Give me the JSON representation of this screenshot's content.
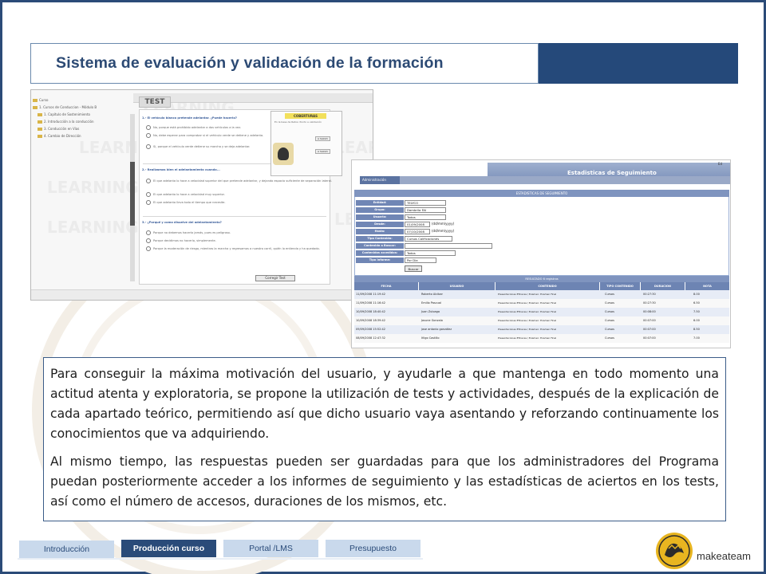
{
  "title": "Sistema de evaluación y validación de la formación",
  "colors": {
    "brand": "#25497a",
    "accent": "#c9d9ec",
    "logo": "#e8b520"
  },
  "shot_test": {
    "tab_label": "TEST",
    "watermark": "LEARNING",
    "tree": [
      "Curso",
      "1. Cursos de Conduccion - Módulo B",
      "1. Capítulo de Sostenimiento",
      "2. Introducción a la conducción",
      "3. Conducción en Vías",
      "4. Cambio de Dirección"
    ],
    "questions": [
      {
        "q": "1.- El vehículo blanco pretende adelantar. ¿Puede hacerlo?",
        "options": [
          "No, porque está prohibido adelantar a dos vehículos a la vez.",
          "No, debe esperar para comprobar si el vehículo verde se detiene y adelanta.",
          "Sí, porque el vehículo verde detiene su marcha y se deja adelantar."
        ]
      },
      {
        "q": "2.- Realizamos bien el adelantamiento cuando...",
        "options": [
          "El que adelanta lo hace a velocidad superior del que pretende adelantar, y dejando espacio suficiente de separación lateral.",
          "El que adelanta lo hace a velocidad muy superior.",
          "El que adelanta lleva todo el tiempo que necesite."
        ]
      },
      {
        "q": "3.- ¿Porqué y como disuelve del adelantamiento?",
        "options": [
          "Porque no debemos hacerlo jamás, pues es peligroso.",
          "Porque decidimos no hacerlo, simplemente.",
          "Porque la moderación de riesgo, mientras la marcha y regresamos a nuestro carril, quién lo entienda y ha quedado."
        ]
      }
    ],
    "coberturas": {
      "title": "COBERTURAS",
      "subtitle": "En la base de Retos: Punto a validación",
      "btn_a": "A SALVO",
      "btn_b": "A SALVO"
    },
    "submit": "Corregir Test"
  },
  "shot_stats": {
    "header": "Estadisticas de Seguimiento",
    "edit": "Ed",
    "tab": "Administración",
    "box_title": "ESTADISTICAS DE SEGUIMIENTO",
    "form": [
      {
        "label": "Entidad:",
        "value": "TELYCO"
      },
      {
        "label": "Grupo:",
        "value": "Dambrila FAI"
      },
      {
        "label": "Usuario:",
        "value": "Todos"
      },
      {
        "label": "Desde:",
        "value": "01/09/2008",
        "hint": "(dd/mm/yyyy)"
      },
      {
        "label": "Hasta:",
        "value": "07/10/2008",
        "hint": "(dd/mm/yyyy)"
      },
      {
        "label": "Tipo Contenido:",
        "value": "Cursos Calificaciones"
      },
      {
        "label": "Contenido a Buscar:",
        "value": ""
      },
      {
        "label": "Contenidos accedidos:",
        "value": "Todos"
      },
      {
        "label": "Tipo Informe:",
        "value": "Por Dia"
      }
    ],
    "search_button": "Buscar",
    "result_title": "RESULTADO 6 registros",
    "columns": [
      "FECHA",
      "USUARIO",
      "CONTENIDO",
      "TIPO CONTENIDO",
      "DURACION",
      "NOTA"
    ],
    "rows": [
      [
        "11/09/2008 11:19:42",
        "Roberto Alcibar",
        "Presentaciones Eficaces / Examen: Examen Final",
        "Cursos",
        "00:27:30",
        "8.00"
      ],
      [
        "11/09/2008 11:16:42",
        "Emilio Pascual",
        "Presentaciones Eficaces / Examen: Examen Final",
        "Cursos",
        "00:27:30",
        "6.50"
      ],
      [
        "10/09/2008 18:40:42",
        "Juan Zuloaga",
        "Presentaciones Eficaces / Examen: Examen Final",
        "Cursos",
        "00:08:00",
        "7.50"
      ],
      [
        "10/09/2008 18:39:42",
        "Josune Gonzalo",
        "Presentaciones Eficaces / Examen: Examen Final",
        "Cursos",
        "00:07:00",
        "6.00"
      ],
      [
        "09/09/2008 15:52:42",
        "jose antonio gonzález",
        "Presentaciones Eficaces / Examen: Examen Final",
        "Cursos",
        "00:07:00",
        "8.50"
      ],
      [
        "08/09/2008 12:47:32",
        "Iñigo Castillo",
        "Presentaciones Eficaces / Examen: Examen Final",
        "Cursos",
        "00:07:00",
        "7.00"
      ]
    ]
  },
  "body": {
    "p1": "Para conseguir la máxima motivación del usuario, y ayudarle a que mantenga en todo momento una actitud atenta y exploratoria, se propone la utilización de tests y actividades, después de la explicación de cada apartado teórico, permitiendo así que dicho usuario vaya asentando y reforzando continuamente los conocimientos que va adquiriendo.",
    "p2": "Al mismo tiempo, las respuestas pueden ser guardadas para que los administradores del Programa puedan posteriormente acceder a los informes de seguimiento y las estadísticas de aciertos en los tests, así como el número de accesos, duraciones de los mismos, etc."
  },
  "nav": {
    "tabs": [
      {
        "label": "Introducción",
        "active": false
      },
      {
        "label": "Producción curso",
        "active": true
      },
      {
        "label": "Portal /LMS",
        "active": false
      },
      {
        "label": "Presupuesto",
        "active": false
      }
    ]
  },
  "logo": {
    "name": "makeateam"
  }
}
